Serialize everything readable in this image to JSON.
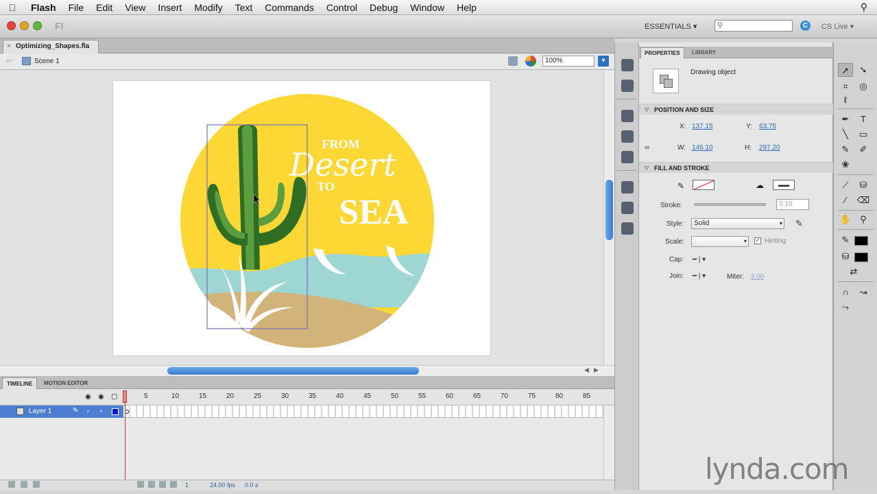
{
  "menubar": {
    "app_name": "Flash",
    "items": [
      "File",
      "Edit",
      "View",
      "Insert",
      "Modify",
      "Text",
      "Commands",
      "Control",
      "Debug",
      "Window",
      "Help"
    ]
  },
  "titlebar": {
    "app_badge": "Fl",
    "workspace": "ESSENTIALS ▾",
    "cs_live": "CS Live ▾"
  },
  "document": {
    "tab_name": "Optimizing_Shapes.fla",
    "scene": "Scene 1",
    "zoom": "100%"
  },
  "artwork": {
    "line_from": "FROM",
    "line_desert": "Desert",
    "line_to": "TO",
    "line_sea": "SEA",
    "colors": {
      "sun": "#fdd835",
      "cactus": "#5a9e3f",
      "cactus_dark": "#2f6e22",
      "water": "#9ed6d3",
      "sand": "#d2b37a"
    }
  },
  "timeline": {
    "tabs": [
      "TIMELINE",
      "MOTION EDITOR"
    ],
    "ruler": [
      "5",
      "10",
      "15",
      "20",
      "25",
      "30",
      "35",
      "40",
      "45",
      "50",
      "55",
      "60",
      "65",
      "70",
      "75",
      "80",
      "85"
    ],
    "layer_name": "Layer 1",
    "fps": "24.00 fps",
    "time": "0.0 s",
    "frame": "1"
  },
  "properties": {
    "tabs": [
      "PROPERTIES",
      "LIBRARY"
    ],
    "object_type": "Drawing object",
    "section_position": "POSITION AND SIZE",
    "x_label": "X:",
    "x_value": "137.15",
    "y_label": "Y:",
    "y_value": "63.75",
    "w_label": "W:",
    "w_value": "146.10",
    "h_label": "H:",
    "h_value": "297.20",
    "section_fill": "FILL AND STROKE",
    "stroke_label": "Stroke:",
    "stroke_value": "0.10",
    "style_label": "Style:",
    "style_value": "Solid",
    "scale_label": "Scale:",
    "scale_value": "",
    "hinting_label": "Hinting",
    "cap_label": "Cap:",
    "cap_value": "━ | ▾",
    "join_label": "Join:",
    "join_value": "━ | ▾",
    "miter_label": "Miter:",
    "miter_value": "3.00"
  },
  "watermark": "lynda.com"
}
